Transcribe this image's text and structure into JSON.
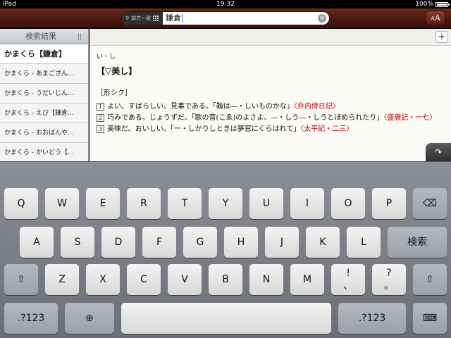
{
  "status_bar": {
    "device": "iPad",
    "time": "19:32",
    "battery": "100%"
  },
  "header": {
    "search_mode": "前方一致",
    "search_query": "鎌倉",
    "font_button_large": "A",
    "font_button_small": "A"
  },
  "sidebar": {
    "title": "検索結果",
    "items": [
      {
        "label": "かまくら【鎌倉】"
      },
      {
        "label": "かまくら - あまござん…"
      },
      {
        "label": "かまくら - うだいじん…"
      },
      {
        "label": "かまくら - えび【鎌倉…"
      },
      {
        "label": "かまくら - おおばんや…"
      },
      {
        "label": "かまくら - かいどう【…"
      }
    ]
  },
  "content": {
    "plus_label": "+",
    "reading": "い・し",
    "headword": "【▽美し】",
    "pos": "［形シク］",
    "definitions": [
      {
        "num": "1",
        "text": "よい。すばらしい。見事である。「鞠は―・しいものかな」",
        "source": "〈弁内侍日記〉"
      },
      {
        "num": "2",
        "text": "巧みである。じょうずだ。「歌の音(こゑ)のよさよ、―・しう―・しうとほめられたり」",
        "source": "〈盛衰記・一七〉"
      },
      {
        "num": "3",
        "text": "美味だ。おいしい。「一・しかりしときは夢窓にくらはれて」",
        "source": "〈太平記・二三〉"
      }
    ]
  },
  "keyboard": {
    "row1": [
      "Q",
      "W",
      "E",
      "R",
      "T",
      "Y",
      "U",
      "I",
      "O",
      "P"
    ],
    "row2": [
      "A",
      "S",
      "D",
      "F",
      "G",
      "H",
      "J",
      "K",
      "L"
    ],
    "row3": [
      "Z",
      "X",
      "C",
      "V",
      "B",
      "N",
      "M"
    ],
    "search_key": "検索",
    "excl_top": "!",
    "excl_bottom": "、",
    "quest_top": "?",
    "quest_bottom": "。",
    "numbers_key": ".?123"
  }
}
